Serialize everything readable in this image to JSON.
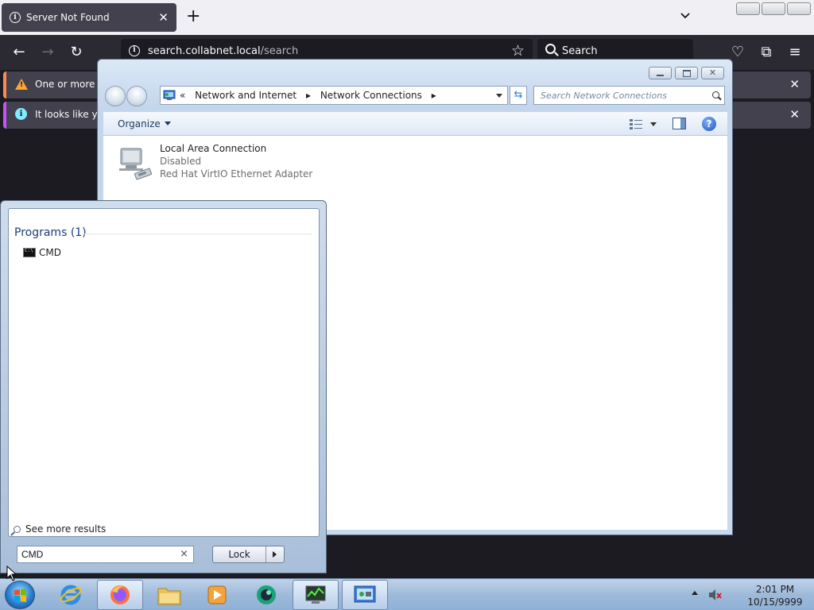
{
  "firefox": {
    "tab_title": "Server Not Found",
    "url_host": "search.collabnet.local",
    "url_path": "/search",
    "search_placeholder": "Search",
    "notif_warning": "One or more ir",
    "notif_info": "It looks like you"
  },
  "explorer": {
    "breadcrumb_prefix": "«",
    "breadcrumb": [
      "Network and Internet",
      "Network Connections"
    ],
    "search_placeholder": "Search Network Connections",
    "organize": "Organize",
    "connection": {
      "name": "Local Area Connection",
      "status": "Disabled",
      "adapter": "Red Hat VirtIO Ethernet Adapter"
    }
  },
  "startmenu": {
    "programs_header": "Programs (1)",
    "program_item": "CMD",
    "see_more": "See more results",
    "search_value": "CMD",
    "lock_label": "Lock"
  },
  "taskbar": {
    "time": "2:01 PM",
    "date": "10/15/9999",
    "items": [
      "internet-explorer",
      "firefox",
      "windows-explorer",
      "media-player",
      "green-app",
      "task-manager",
      "network-control-panel"
    ]
  },
  "colors": {
    "ff_dark": "#1c1b22",
    "ff_toolbar": "#2b2a33",
    "warning": "#ffa436",
    "info": "#80ebff",
    "win7_header": "#1e3c78"
  }
}
